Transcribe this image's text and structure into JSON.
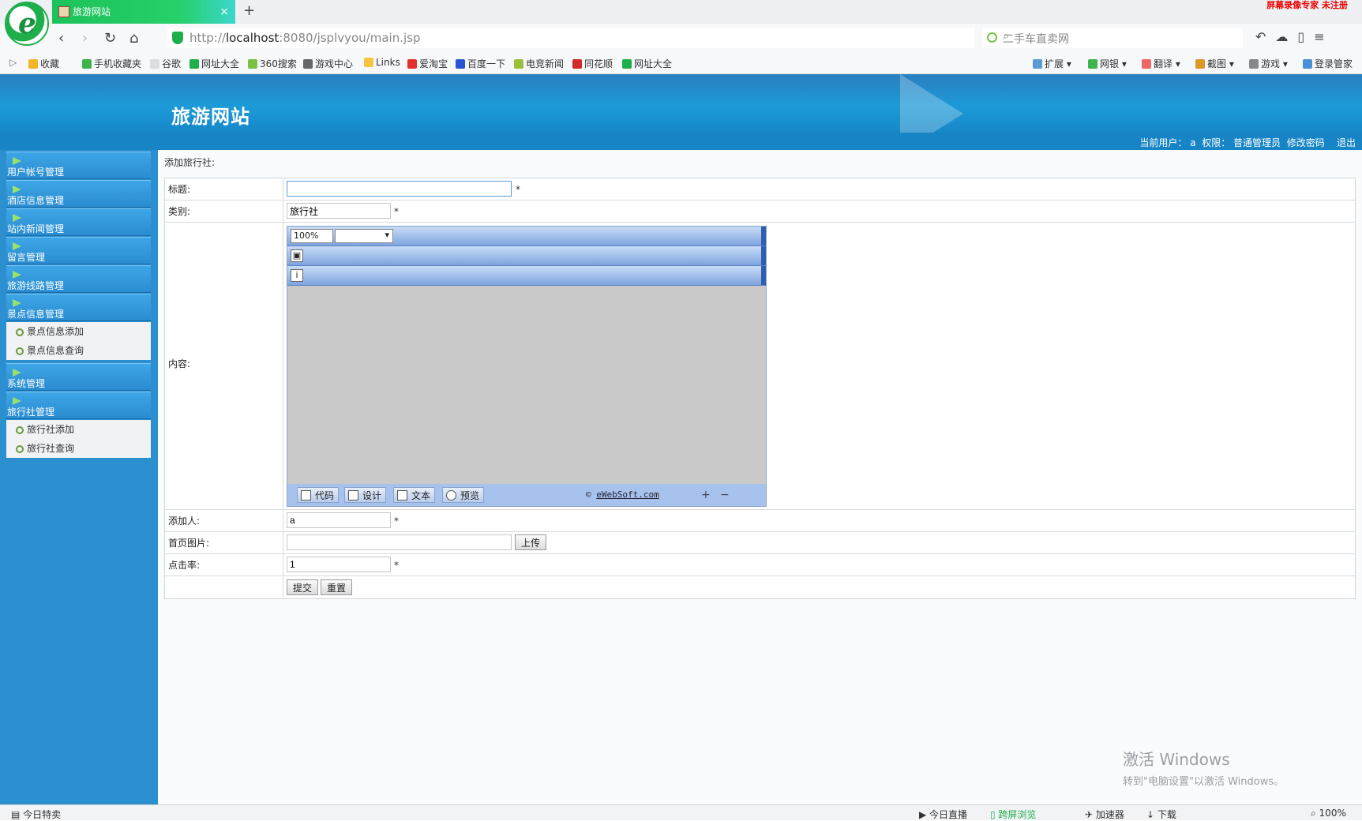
{
  "browser": {
    "tab_title": "旅游网站",
    "new_tab_symbol": "+",
    "close_symbol": "×",
    "recorder_watermark": "屏幕录像专家 未注册",
    "url_prefix": "http://",
    "url_host": "localhost",
    "url_path": ":8080/jsplvyou/main.jsp",
    "search_placeholder": "二手车直卖网",
    "bookmarks": [
      "收藏",
      "手机收藏夹",
      "谷歌",
      "网址大全",
      "360搜索",
      "游戏中心",
      "Links",
      "爱淘宝",
      "百度一下",
      "电竞新闻",
      "同花顺",
      "网址大全"
    ],
    "right_tools": [
      "扩展",
      "网银",
      "翻译",
      "截图",
      "游戏",
      "登录管家"
    ],
    "status_left": "今日特卖",
    "status_right": [
      "今日直播",
      "跨屏浏览",
      "加速器",
      "下载",
      "100%"
    ]
  },
  "site": {
    "title": "旅游网站",
    "user_label": "当前用户：",
    "user_name": "a",
    "role_label": "权限：",
    "role_name": "普通管理员",
    "change_password": "修改密码",
    "logout": "退出"
  },
  "sidebar": {
    "menus": [
      {
        "label": "用户帐号管理"
      },
      {
        "label": "酒店信息管理"
      },
      {
        "label": "站内新闻管理"
      },
      {
        "label": "留言管理"
      },
      {
        "label": "旅游线路管理"
      },
      {
        "label": "景点信息管理"
      },
      {
        "label": "系统管理"
      },
      {
        "label": "旅行社管理"
      }
    ],
    "scenic_sub": [
      "景点信息添加",
      "景点信息查询"
    ],
    "agency_sub": [
      "旅行社添加",
      "旅行社查询"
    ]
  },
  "form": {
    "page_title": "添加旅行社:",
    "required_mark": "*",
    "title_label": "标题:",
    "title_value": "",
    "type_label": "类别:",
    "type_value": "旅行社",
    "content_label": "内容:",
    "editor": {
      "zoom": "100%",
      "font_select": "",
      "modes": [
        "代码",
        "设计",
        "文本",
        "预览"
      ],
      "credit_symbol": "©",
      "credit_link": "eWebSoft.com",
      "zoom_in": "+",
      "zoom_out": "−"
    },
    "adder_label": "添加人:",
    "adder_value": "a",
    "image_label": "首页图片:",
    "image_value": "",
    "upload_button": "上传",
    "clicks_label": "点击率:",
    "clicks_value": "1",
    "submit_button": "提交",
    "reset_button": "重置"
  },
  "windows_watermark": {
    "line1": "激活 Windows",
    "line2": "转到\"电脑设置\"以激活 Windows。"
  },
  "colors": {
    "header_blue": "#1d9ad8",
    "sidebar_blue": "#2c8fd0",
    "tab_green": "#1cc25a",
    "editor_toolbar": "#9cbbe8"
  }
}
